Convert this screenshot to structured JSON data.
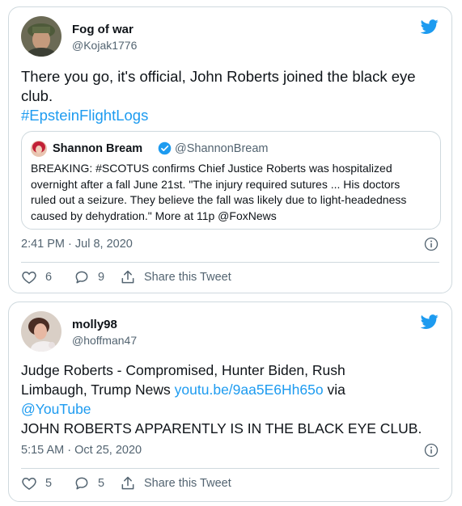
{
  "tweets": [
    {
      "name": "Fog of war",
      "handle": "@Kojak1776",
      "text_line1": "There you go, it's official, John Roberts joined the black eye",
      "text_line2": "club.",
      "hashtag": "#EpsteinFlightLogs",
      "quote": {
        "name": "Shannon Bream",
        "handle": "@ShannonBream",
        "lines": [
          "BREAKING:  #SCOTUS confirms Chief Justice Roberts was hospitalized",
          "overnight after a fall June 21st.  \"The injury required sutures ... His doctors",
          "ruled out a seizure. They believe the fall was likely due to light-headedness",
          "caused by dehydration.\" More at 11p @FoxNews"
        ]
      },
      "timestamp": "2:41 PM · Jul 8, 2020",
      "likes": "6",
      "replies": "9",
      "share_label": "Share this Tweet"
    },
    {
      "name": "molly98",
      "handle": "@hoffman47",
      "line1": "Judge Roberts - Compromised, Hunter Biden, Rush",
      "line2_prefix": "Limbaugh, Trump News ",
      "line2_link": "youtu.be/9aa5E6Hh65o",
      "line2_suffix": " via",
      "line3_link": "@YouTube",
      "line4": "JOHN ROBERTS APPARENTLY IS IN THE BLACK EYE CLUB.",
      "timestamp": "5:15 AM · Oct 25, 2020",
      "likes": "5",
      "replies": "5",
      "share_label": "Share this Tweet"
    }
  ],
  "colors": {
    "accent": "#1d9bf0",
    "border": "#cfd9de",
    "muted": "#536471"
  }
}
